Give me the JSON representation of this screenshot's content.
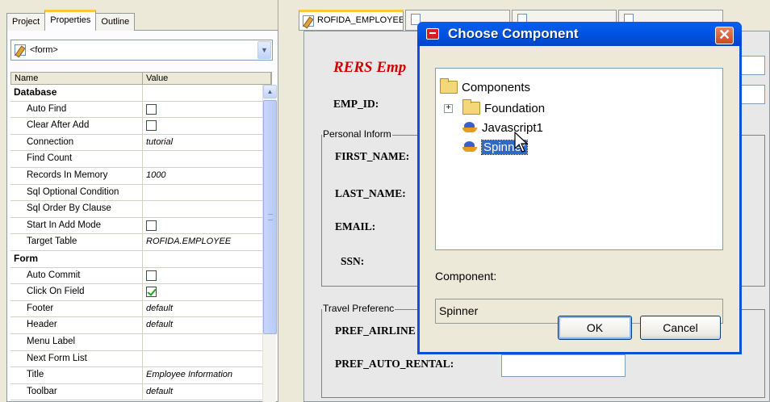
{
  "left_panel": {
    "tabs": [
      "Project",
      "Properties",
      "Outline"
    ],
    "active_tab": "Properties",
    "form_selector": {
      "value": "<form>",
      "icon": "pencil-icon"
    },
    "columns": [
      "Name",
      "Value"
    ],
    "rows": [
      {
        "name": "Database",
        "category": true
      },
      {
        "name": "Auto Find",
        "checkbox": false
      },
      {
        "name": "Clear After Add",
        "checkbox": false
      },
      {
        "name": "Connection",
        "value": "tutorial"
      },
      {
        "name": "Find Count",
        "value": ""
      },
      {
        "name": "Records In Memory",
        "value": "1000"
      },
      {
        "name": "Sql Optional Condition",
        "value": ""
      },
      {
        "name": "Sql Order By Clause",
        "value": ""
      },
      {
        "name": "Start In Add Mode",
        "checkbox": false
      },
      {
        "name": "Target Table",
        "value": "ROFIDA.EMPLOYEE"
      },
      {
        "name": "Form",
        "category": true
      },
      {
        "name": "Auto Commit",
        "checkbox": false
      },
      {
        "name": "Click On Field",
        "checkbox": true
      },
      {
        "name": "Footer",
        "value": "default"
      },
      {
        "name": "Header",
        "value": "default"
      },
      {
        "name": "Menu Label",
        "value": ""
      },
      {
        "name": "Next Form List",
        "value": ""
      },
      {
        "name": "Title",
        "value": "Employee Information"
      },
      {
        "name": "Toolbar",
        "value": "default"
      }
    ]
  },
  "editor": {
    "tabs": [
      {
        "label": "ROFIDA_EMPLOYEE",
        "active": true
      },
      {
        "label": "",
        "active": false
      },
      {
        "label": "",
        "active": false
      },
      {
        "label": "",
        "active": false
      }
    ],
    "form_title": "RERS Emp",
    "labels": {
      "emp_id": "EMP_ID:",
      "first_name": "FIRST_NAME:",
      "last_name": "LAST_NAME:",
      "email": "EMAIL:",
      "ssn": "SSN:",
      "pref_airline": "PREF_AIRLINE",
      "pref_auto_rental": "PREF_AUTO_RENTAL:"
    },
    "groups": {
      "personal": "Personal Inform",
      "travel": "Travel Preferenc"
    }
  },
  "dialog": {
    "title": "Choose Component",
    "tree": {
      "root": "Components",
      "children": [
        {
          "label": "Foundation",
          "type": "folder",
          "expandable": true
        },
        {
          "label": "Javascript1",
          "type": "bean"
        },
        {
          "label": "Spinner",
          "type": "bean",
          "selected": true
        }
      ]
    },
    "component_label": "Component:",
    "component_value": "Spinner",
    "ok_label": "OK",
    "cancel_label": "Cancel"
  }
}
